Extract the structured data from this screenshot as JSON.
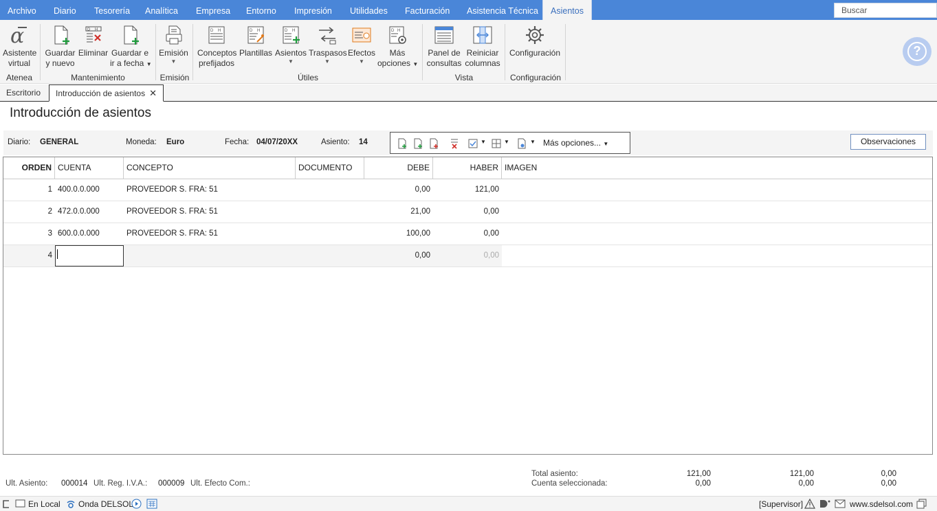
{
  "menu": {
    "items": [
      "Archivo",
      "Diario",
      "Tesorería",
      "Analítica",
      "Empresa",
      "Entorno",
      "Impresión",
      "Utilidades",
      "Facturación",
      "Asistencia Técnica",
      "Asientos"
    ],
    "search_placeholder": "Buscar"
  },
  "ribbon": {
    "asistente": [
      "Asistente",
      "virtual"
    ],
    "guardar_nuevo": [
      "Guardar",
      "y nuevo"
    ],
    "eliminar": "Eliminar",
    "guardar_fecha": [
      "Guardar e",
      "ir a fecha"
    ],
    "emision": "Emisión",
    "conceptos": [
      "Conceptos",
      "prefijados"
    ],
    "plantillas": "Plantillas",
    "asientos": "Asientos",
    "traspasos": "Traspasos",
    "efectos": "Efectos",
    "mas_opciones": [
      "Más",
      "opciones"
    ],
    "panel": [
      "Panel de",
      "consultas"
    ],
    "reiniciar": [
      "Reiniciar",
      "columnas"
    ],
    "configuracion": "Configuración",
    "groups": {
      "atenea": "Atenea",
      "mantenimiento": "Mantenimiento",
      "emision": "Emisión",
      "utiles": "Útiles",
      "vista": "Vista",
      "configuracion": "Configuración"
    }
  },
  "tabs": {
    "escritorio": "Escritorio",
    "introduccion": "Introducción de asientos"
  },
  "page_title": "Introducción de asientos",
  "info": {
    "diario_label": "Diario:",
    "diario_value": "GENERAL",
    "moneda_label": "Moneda:",
    "moneda_value": "Euro",
    "fecha_label": "Fecha:",
    "fecha_value": "04/07/20XX",
    "asiento_label": "Asiento:",
    "asiento_value": "14",
    "mas_opciones": "Más opciones...",
    "observaciones": "Observaciones"
  },
  "grid": {
    "headers": {
      "orden": "ORDEN",
      "cuenta": "CUENTA",
      "concepto": "CONCEPTO",
      "documento": "DOCUMENTO",
      "debe": "DEBE",
      "haber": "HABER",
      "imagen": "IMAGEN"
    },
    "rows": [
      {
        "orden": "1",
        "cuenta": "400.0.0.000",
        "concepto": "PROVEEDOR S. FRA: 51",
        "documento": "",
        "debe": "0,00",
        "haber": "121,00"
      },
      {
        "orden": "2",
        "cuenta": "472.0.0.000",
        "concepto": "PROVEEDOR S. FRA: 51",
        "documento": "",
        "debe": "21,00",
        "haber": "0,00"
      },
      {
        "orden": "3",
        "cuenta": "600.0.0.000",
        "concepto": "PROVEEDOR S. FRA: 51",
        "documento": "",
        "debe": "100,00",
        "haber": "0,00"
      }
    ],
    "new_row": {
      "orden": "4",
      "cuenta": "",
      "debe": "0,00",
      "haber": "0,00"
    }
  },
  "footer": {
    "ult_asiento_label": "Ult. Asiento:",
    "ult_asiento_value": "000014",
    "ult_reg_label": "Ult. Reg. I.V.A.:",
    "ult_reg_value": "000009",
    "ult_efecto_label": "Ult. Efecto Com.:",
    "total_label": "Total asiento:",
    "cuenta_label": "Cuenta seleccionada:",
    "total_values": [
      "121,00",
      "121,00",
      "0,00"
    ],
    "cuenta_values": [
      "0,00",
      "0,00",
      "0,00"
    ]
  },
  "status": {
    "en_local": "En Local",
    "onda": "Onda DELSOL",
    "supervisor": "[Supervisor]",
    "web": "www.sdelsol.com"
  },
  "colors": {
    "menu_bg": "#4a86d8",
    "ribbon_bg": "#f4f4f4",
    "accent": "#3a6fbd"
  }
}
